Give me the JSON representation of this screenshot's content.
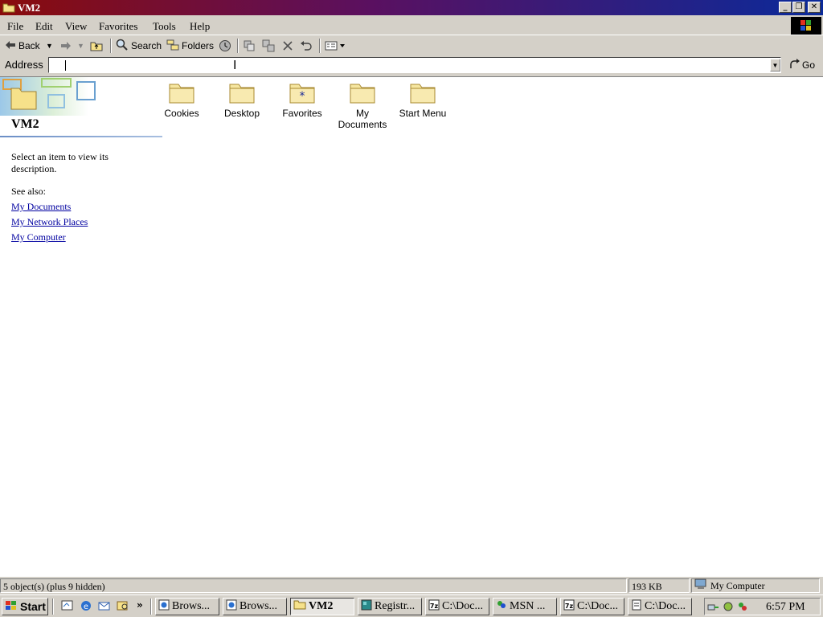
{
  "window": {
    "title": "VM2"
  },
  "menu": [
    "File",
    "Edit",
    "View",
    "Favorites",
    "Tools",
    "Help"
  ],
  "toolbar": {
    "back_label": "Back",
    "search_label": "Search",
    "folders_label": "Folders"
  },
  "address": {
    "label": "Address",
    "value": "",
    "go_label": "Go"
  },
  "panel": {
    "folder_name": "VM2",
    "description": "Select an item to view its description.",
    "see_also_label": "See also:",
    "links": [
      "My Documents",
      "My Network Places",
      "My Computer"
    ]
  },
  "items": [
    {
      "label": "Cookies",
      "icon": "folder-icon"
    },
    {
      "label": "Desktop",
      "icon": "folder-icon"
    },
    {
      "label": "Favorites",
      "icon": "favorites-folder-icon"
    },
    {
      "label": "My Documents",
      "icon": "folder-icon"
    },
    {
      "label": "Start Menu",
      "icon": "folder-icon"
    }
  ],
  "status": {
    "objects": "5 object(s) (plus 9 hidden)",
    "size": "193 KB",
    "zone": "My Computer"
  },
  "taskbar": {
    "start_label": "Start",
    "tasks": [
      "Brows...",
      "Brows...",
      "VM2",
      "Registr...",
      "C:\\Doc...",
      "MSN ...",
      "C:\\Doc...",
      "C:\\Doc..."
    ],
    "active_task": "VM2",
    "clock": "6:57 PM"
  },
  "colors": {
    "link": "#0000a0",
    "face": "#d4d0c8",
    "folder": "#f6e6a0"
  }
}
